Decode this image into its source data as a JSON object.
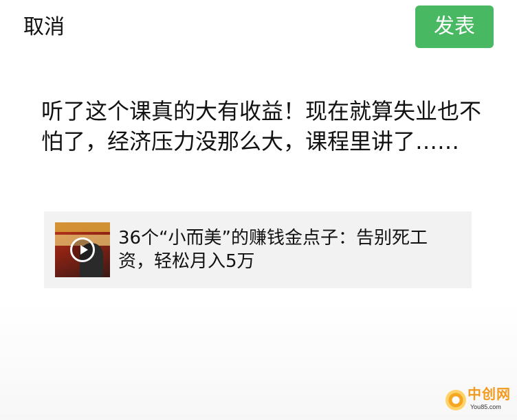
{
  "header": {
    "cancel_label": "取消",
    "publish_label": "发表",
    "publish_color": "#49b863"
  },
  "post": {
    "text": "听了这个课真的大有收益！现在就算失业也不怕了，经济压力没那么大，课程里讲了……"
  },
  "shared_link": {
    "title": "36个“小而美”的赚钱金点子：告别死工资，轻松月入5万",
    "thumbnail_icon": "video-play-icon"
  },
  "watermark": {
    "brand": "中创网",
    "domain": "You85.com"
  }
}
